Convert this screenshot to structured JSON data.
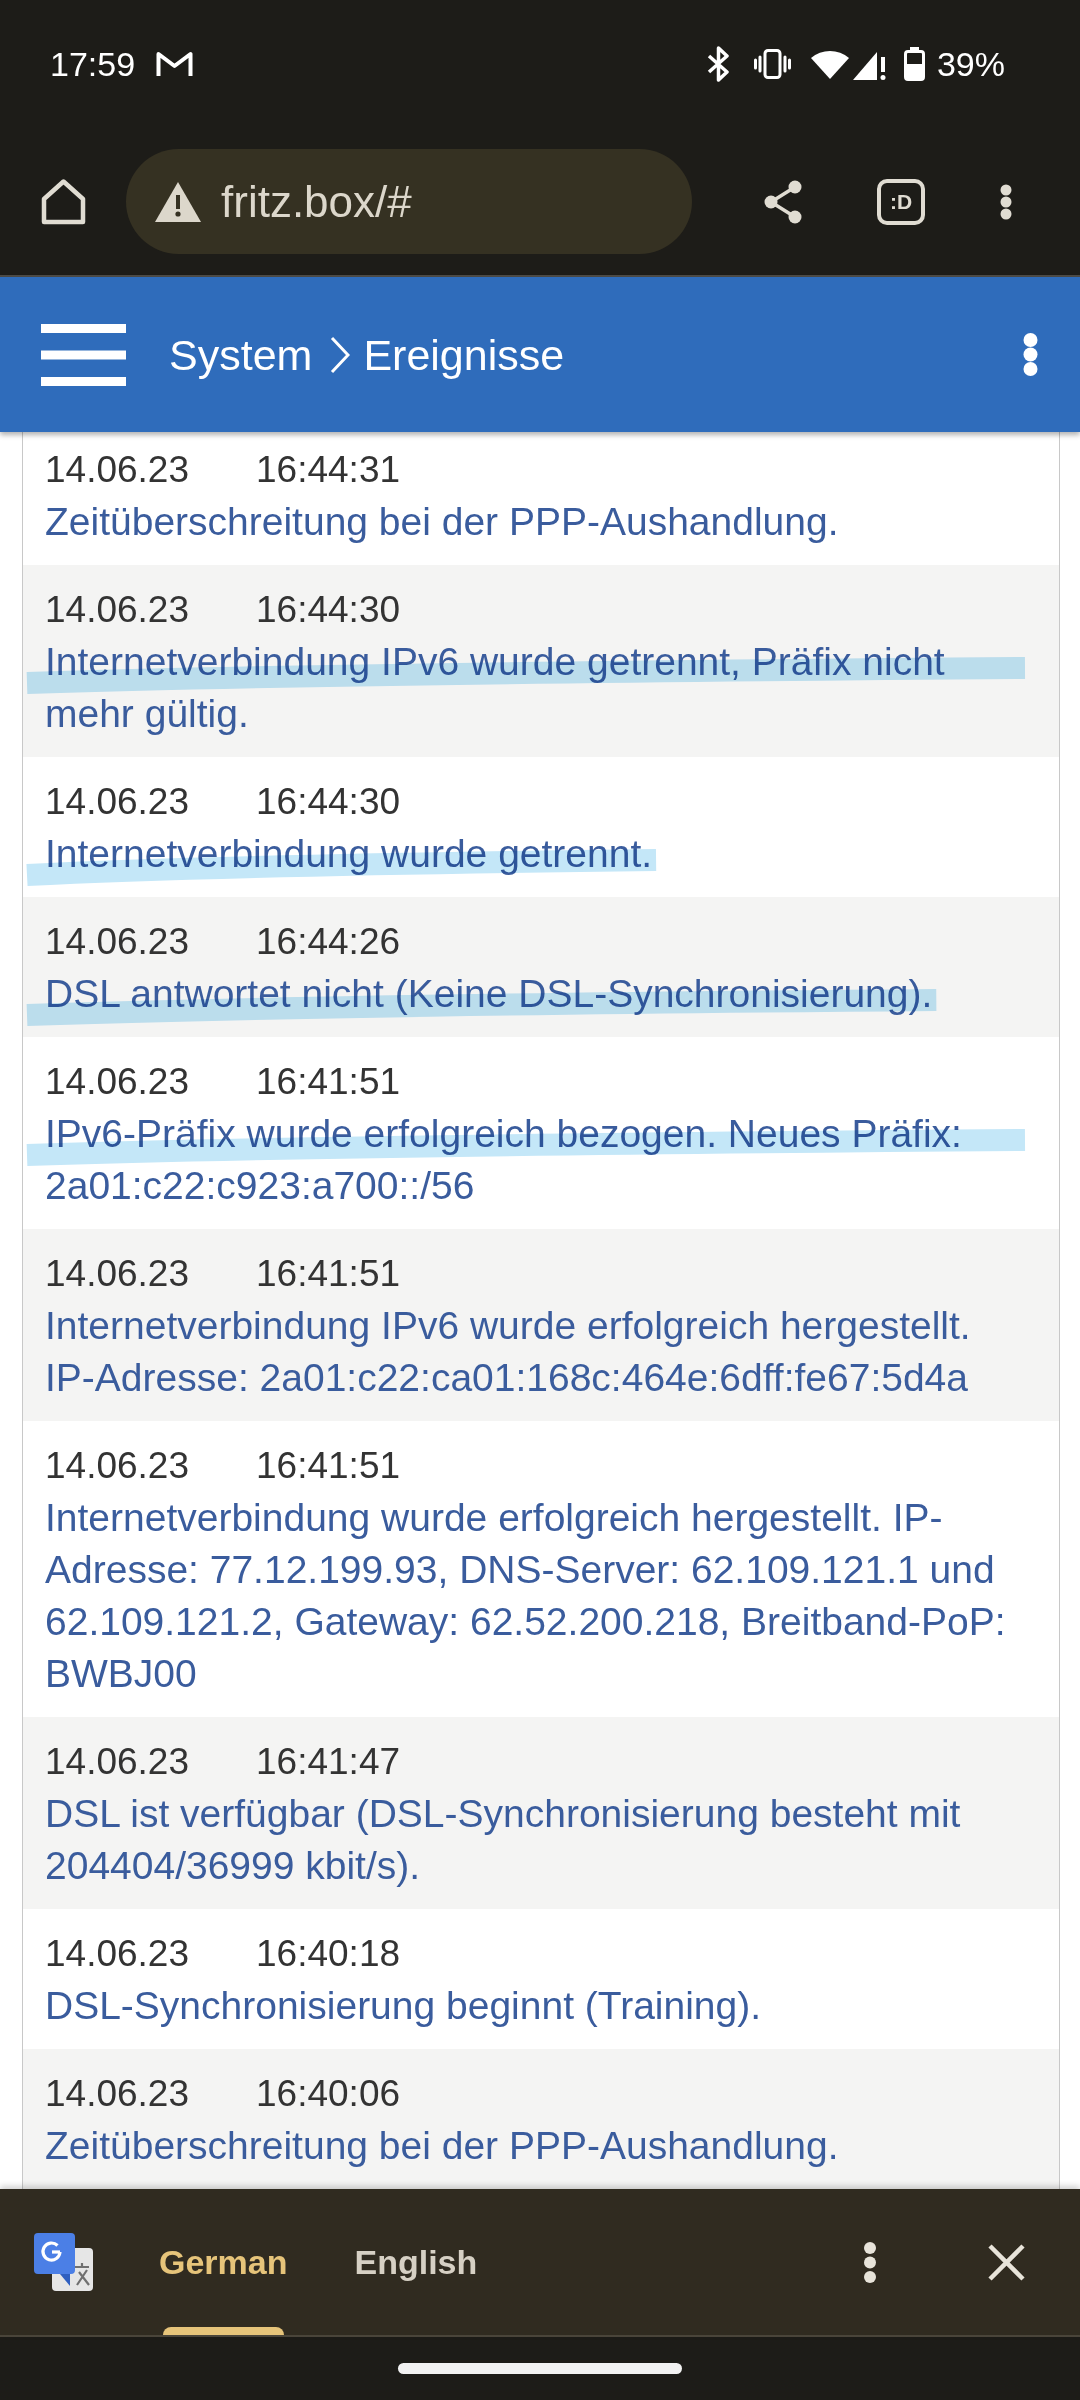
{
  "status_bar": {
    "time": "17:59",
    "battery": "39%"
  },
  "browser_toolbar": {
    "url": "fritz.box/#",
    "tab_count": ":D"
  },
  "header": {
    "breadcrumb": [
      {
        "label": "System"
      },
      {
        "label": "Ereignisse"
      }
    ]
  },
  "events": [
    {
      "date": "14.06.23",
      "time": "16:44:31",
      "message": "Zeitüberschreitung bei der PPP-Aushandlung.",
      "highlighted": false
    },
    {
      "date": "14.06.23",
      "time": "16:44:30",
      "message": "Internetverbindung IPv6 wurde getrennt, Präfix nicht mehr gültig.",
      "highlighted": true
    },
    {
      "date": "14.06.23",
      "time": "16:44:30",
      "message": "Internetverbindung wurde getrennt.",
      "highlighted": true
    },
    {
      "date": "14.06.23",
      "time": "16:44:26",
      "message": "DSL antwortet nicht (Keine DSL-Synchronisierung).",
      "highlighted": true
    },
    {
      "date": "14.06.23",
      "time": "16:41:51",
      "message": "IPv6-Präfix wurde erfolgreich bezogen. Neues Präfix: 2a01:c22:c923:a700::/56",
      "highlighted": true
    },
    {
      "date": "14.06.23",
      "time": "16:41:51",
      "message": "Internetverbindung IPv6 wurde erfolgreich hergestellt. IP-Adresse: 2a01:c22:ca01:168c:464e:6dff:fe67:5d4a",
      "highlighted": false
    },
    {
      "date": "14.06.23",
      "time": "16:41:51",
      "message": "Internetverbindung wurde erfolgreich hergestellt. IP-Adresse: 77.12.199.93, DNS-Server: 62.109.121.1 und 62.109.121.2, Gateway: 62.52.200.218, Breitband-PoP: BWBJ00",
      "highlighted": false
    },
    {
      "date": "14.06.23",
      "time": "16:41:47",
      "message": "DSL ist verfügbar (DSL-Synchronisierung besteht mit 204404/36999 kbit/s).",
      "highlighted": false
    },
    {
      "date": "14.06.23",
      "time": "16:40:18",
      "message": "DSL-Synchronisierung beginnt (Training).",
      "highlighted": false
    },
    {
      "date": "14.06.23",
      "time": "16:40:06",
      "message": "Zeitüberschreitung bei der PPP-Aushandlung.",
      "highlighted": false
    }
  ],
  "translate_bar": {
    "languages": [
      {
        "label": "German",
        "selected": true
      },
      {
        "label": "English",
        "selected": false
      }
    ]
  }
}
